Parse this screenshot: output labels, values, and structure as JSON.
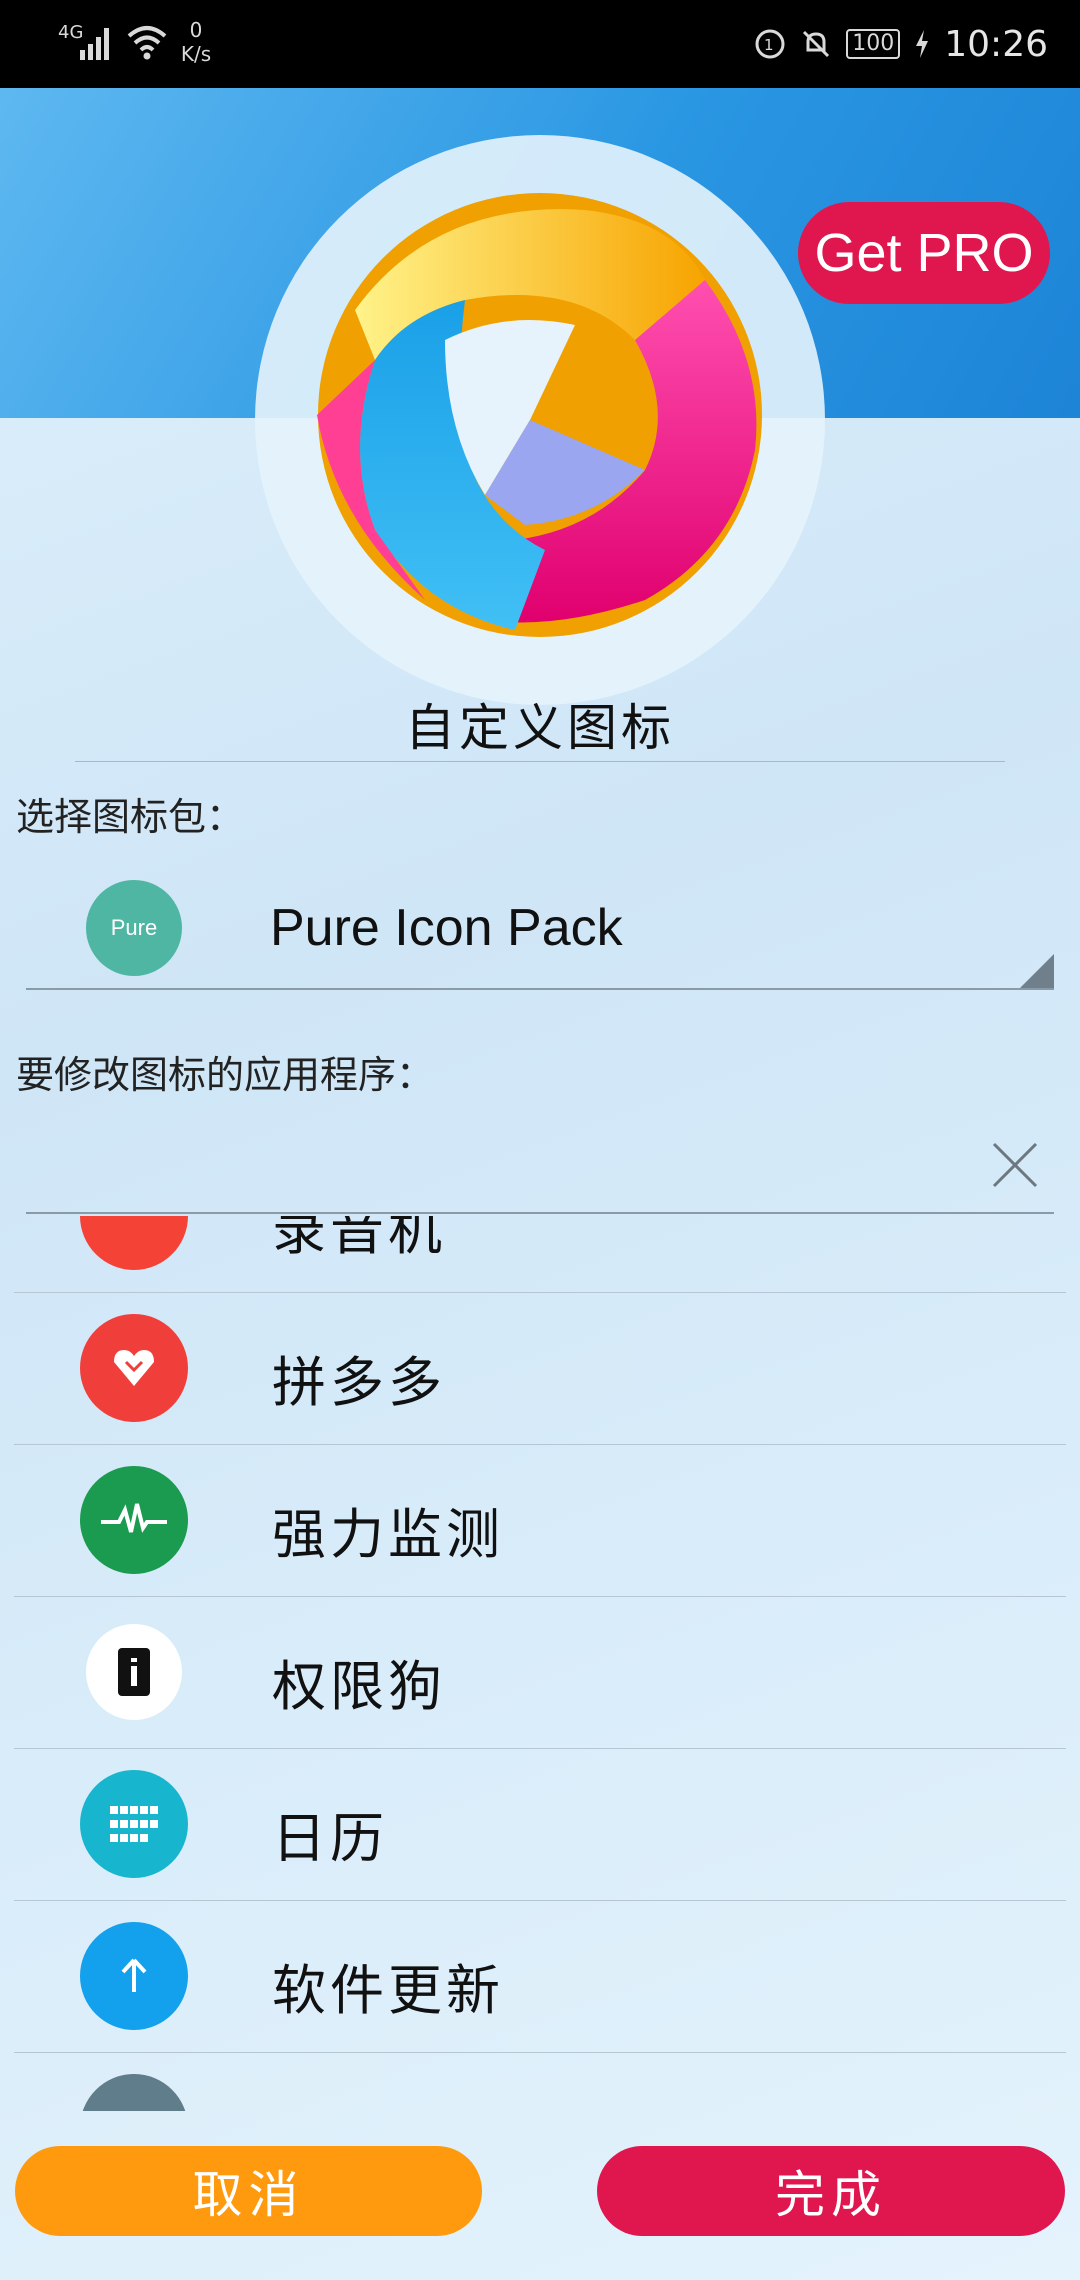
{
  "status_bar": {
    "network": "4G",
    "speed_value": "0",
    "speed_unit": "K/s",
    "battery": "100",
    "time": "10:26"
  },
  "header": {
    "get_pro_label": "Get PRO",
    "title": "自定义图标"
  },
  "icon_pack": {
    "label": "选择图标包：",
    "icon_text": "Pure",
    "selected": "Pure Icon Pack"
  },
  "app_section": {
    "label": "要修改图标的应用程序："
  },
  "apps": [
    {
      "label": "录音机",
      "color": "#f44336",
      "icon": "mic-icon"
    },
    {
      "label": "拼多多",
      "color": "#f03f3a",
      "icon": "pinduoduo-icon"
    },
    {
      "label": "强力监测",
      "color": "#1b9b4f",
      "icon": "heartbeat-icon"
    },
    {
      "label": "权限狗",
      "color": "#ffffff",
      "icon": "phone-info-icon"
    },
    {
      "label": "日历",
      "color": "#18b5cf",
      "icon": "calendar-grid-icon"
    },
    {
      "label": "软件更新",
      "color": "#13a0ec",
      "icon": "arrow-up-icon"
    },
    {
      "label": "",
      "color": "#607d8b",
      "icon": "app-icon"
    }
  ],
  "buttons": {
    "cancel": "取消",
    "done": "完成"
  },
  "colors": {
    "accent_red": "#e0174e",
    "accent_orange": "#ff9a0e",
    "header_blue": "#2a97e3"
  }
}
